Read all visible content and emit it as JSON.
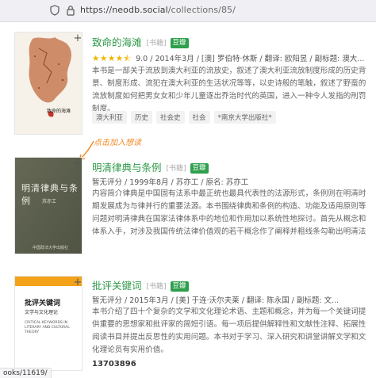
{
  "browser": {
    "url_host": "https://neodb.social",
    "url_path": "/collections/85/"
  },
  "annotation": {
    "text": "点击加入想读"
  },
  "books": [
    {
      "title": "致命的海滩",
      "type": "[书籍]",
      "badge": "豆瓣",
      "rating_stars": 4.5,
      "score": "9.0",
      "meta": "/ 2014年3月 / [澳] 罗伯特·休斯 / 翻译: 欧阳昱 / 副标题: 澳大...",
      "description": "本书是一部关于流放到澳大利亚的流放史，叙述了澳大利亚流放制度形成的历史背景、制度形成、流犯在澳大利亚的生活状况等等，以史诗般的笔触，叙述了野蛮的流放制度如何把男女女和少年儿童逐出乔治时代的英国，进入一种令人发指的刑罚制度。",
      "tags": [
        "澳大利亚",
        "历史",
        "社会史",
        "社会",
        "*南京大学出版社*"
      ],
      "cover_title": "致命的海滩"
    },
    {
      "title": "明清律典与条例",
      "type": "[书籍]",
      "badge": "豆瓣",
      "score_text": "暂无评分",
      "meta": "/ 1999年8月 / 苏亦工 / 原名: 苏亦工",
      "description": "内容简介律典是中国固有法系中最正统也最具代表性的法源形式，条例则在明清时期发展成为与律并行的重要法源。本书围绕律典和条例的构造、功能及适用原则等问题对明清律典在国家法律体系中的地位和作用加以系统性地探讨。首先从概念和体系入手，对涉及我国传统法律价值观的若干概念作了阐释并粗线条勾勒出明清法源体...",
      "cover_title": "明清律典与条例",
      "cover_author": "苏亦工",
      "cover_publisher": "中国政法大学出版社"
    },
    {
      "title": "批评关键词",
      "type": "[书籍]",
      "badge": "豆瓣",
      "score_text": "暂无评分",
      "meta": "/ 2015年3月 / [美] 于连·沃尔夫莱 / 翻译: 陈永国 / 副标题: 文...",
      "description": "本书介绍了四十个复杂的文学和文化理论术语、主题和概念，并为每一个关键词提供重要的思想家和批评家的简短引语。每一项后提供解释性和文献性注释、拓展性阅读书目并提出反思性的实用问题。本书对于学习、深入研究和讲堂讲解文学和文化理论员有实用价值。",
      "cover_title": "批评关键词",
      "cover_subtitle": "文学与文化理论",
      "cover_en": "CRITICAL KEYWORDS IN LITERARY AND CULTURAL THEORY",
      "isbn": "13703896"
    }
  ],
  "status_bar": {
    "text": "ooks/11619/"
  },
  "colors": {
    "title_green": "#2f9a4a",
    "douban_badge": "#2e9f4c",
    "star": "#f0b400",
    "annotation": "#f08a24"
  }
}
